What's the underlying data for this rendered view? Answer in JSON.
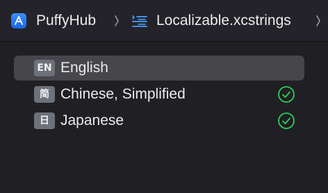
{
  "breadcrumb": {
    "project": "PuffyHub",
    "file": "Localizable.xcstrings"
  },
  "languages": [
    {
      "badge": "EN",
      "name": "English",
      "selected": true,
      "complete": false
    },
    {
      "badge": "简",
      "name": "Chinese, Simplified",
      "selected": false,
      "complete": true
    },
    {
      "badge": "日",
      "name": "Japanese",
      "selected": false,
      "complete": true
    }
  ],
  "colors": {
    "accent": "#2f7af5",
    "check": "#30d158",
    "selection": "#46464b",
    "badge": "#6d7179"
  },
  "icons": {
    "app": "xcode-app-icon",
    "file": "string-catalog-icon",
    "separator": "chevron-right-icon",
    "complete": "checkmark-circle-icon"
  }
}
